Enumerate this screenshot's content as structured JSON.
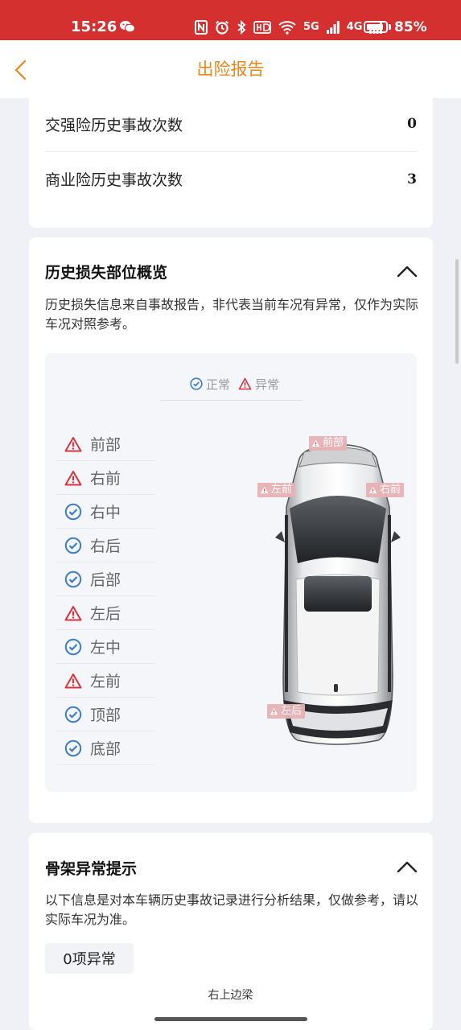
{
  "status_bar": {
    "time": "15:26",
    "network_labels": [
      "5G",
      "4G"
    ],
    "battery": "85%"
  },
  "nav": {
    "title": "出险报告",
    "accent_color": "#e8861a"
  },
  "accident_counts": {
    "items": [
      {
        "label": "交强险历史事故次数",
        "value": "0"
      },
      {
        "label": "商业险历史事故次数",
        "value": "3"
      }
    ]
  },
  "damage_overview": {
    "title": "历史损失部位概览",
    "description": "历史损失信息来自事故报告，非代表当前车况有异常，仅作为实际车况对照参考。",
    "legend": {
      "normal": "正常",
      "abnormal": "异常"
    },
    "parts": [
      {
        "label": "前部",
        "status": "abnormal"
      },
      {
        "label": "右前",
        "status": "abnormal"
      },
      {
        "label": "右中",
        "status": "normal"
      },
      {
        "label": "右后",
        "status": "normal"
      },
      {
        "label": "后部",
        "status": "normal"
      },
      {
        "label": "左后",
        "status": "abnormal"
      },
      {
        "label": "左中",
        "status": "normal"
      },
      {
        "label": "左前",
        "status": "abnormal"
      },
      {
        "label": "顶部",
        "status": "normal"
      },
      {
        "label": "底部",
        "status": "normal"
      }
    ],
    "car_tags": [
      "前部",
      "左前",
      "右前",
      "左后"
    ],
    "colors": {
      "normal": "#3a7fc8",
      "abnormal": "#d8343e"
    }
  },
  "frame": {
    "title": "骨架异常提示",
    "description": "以下信息是对本车辆历史事故记录进行分析结果，仅做参考，请以实际车况为准。",
    "badge": "0项异常",
    "beam_label": "右上边梁"
  }
}
